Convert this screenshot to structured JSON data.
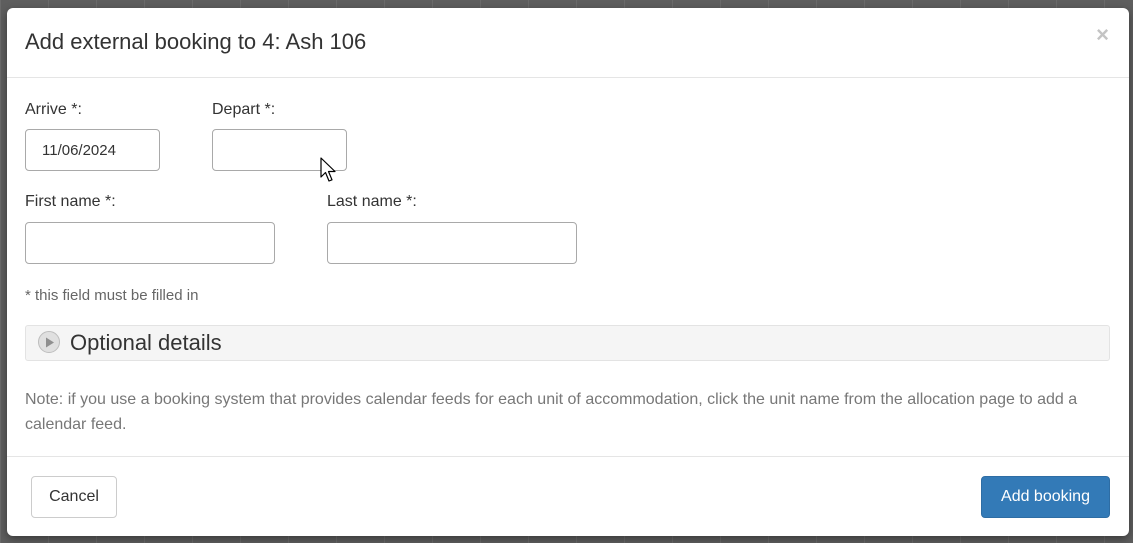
{
  "dialog": {
    "title": "Add external booking to 4: Ash 106",
    "close_symbol": "×"
  },
  "form": {
    "arrive": {
      "label": "Arrive *:",
      "value": "11/06/2024"
    },
    "depart": {
      "label": "Depart *:",
      "value": ""
    },
    "first_name": {
      "label": "First name *:",
      "value": ""
    },
    "last_name": {
      "label": "Last name *:",
      "value": ""
    },
    "required_hint": "* this field must be filled in",
    "optional_details": {
      "label": "Optional details",
      "icon": "play-circle-icon"
    }
  },
  "note": "Note: if you use a booking system that provides calendar feeds for each unit of accommodation, click the unit name from the allocation page to add a calendar feed.",
  "footer": {
    "cancel_label": "Cancel",
    "submit_label": "Add booking"
  },
  "colors": {
    "primary": "#337ab7",
    "header_border": "#e5e5e5",
    "optional_bg": "#f5f5f5"
  }
}
